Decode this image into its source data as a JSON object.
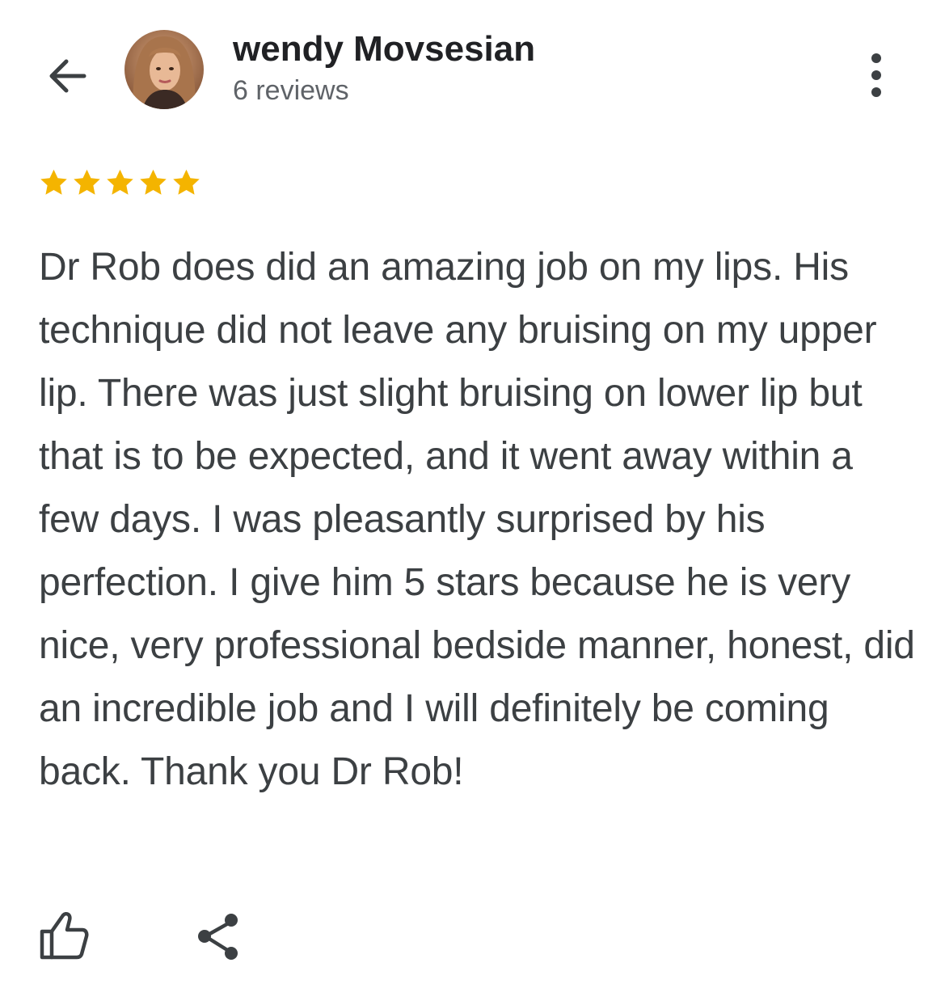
{
  "reviewer": {
    "name": "wendy Movsesian",
    "review_count": "6 reviews"
  },
  "review": {
    "rating": 5,
    "rating_max": 5,
    "star_color": "#f4b400",
    "text": "Dr Rob does did an amazing job on my lips. His technique did not leave any bruising on my upper lip. There was just slight bruising on lower lip but that is to be expected, and it went away within a few days. I was pleasantly surprised by his perfection. I give him 5 stars because he is very nice, very professional bedside manner, honest, did an incredible job and I will definitely be coming back. Thank you Dr Rob!"
  },
  "icons": {
    "back": "arrow-back-icon",
    "more": "more-vert-icon",
    "like": "thumb-up-icon",
    "share": "share-icon",
    "star": "star-icon"
  }
}
